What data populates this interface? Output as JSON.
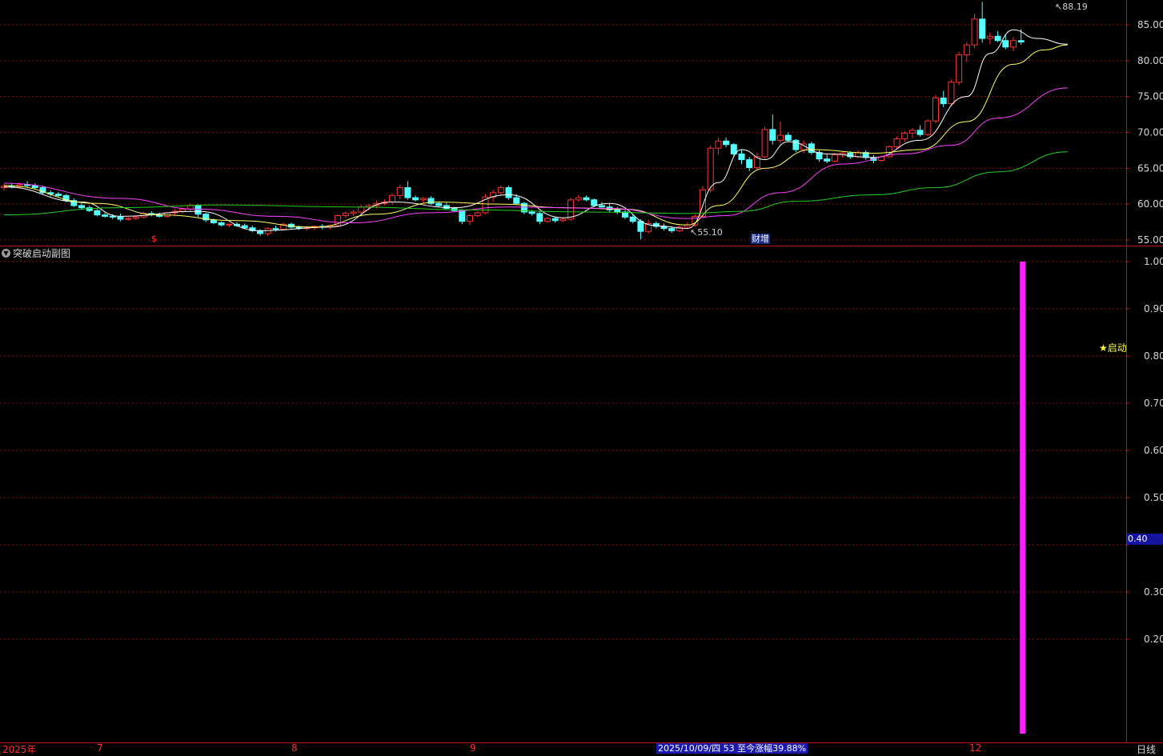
{
  "colors": {
    "up": "#ff3232",
    "down": "#54ffff",
    "ma5": "#ffffff",
    "ma10": "#ffff60",
    "ma20": "#ff40ff",
    "ma60": "#20d020",
    "grid": "#8a1010",
    "frame": "#c01010",
    "signal_bar": "#ff20ff"
  },
  "main_panel": {
    "y_ticks": [
      "85.00",
      "80.00",
      "75.00",
      "70.00",
      "65.00",
      "60.00",
      "55.00"
    ],
    "high_label": "88.19",
    "low_label": "55.10",
    "fin_marker": "财增",
    "s_marker": "$"
  },
  "sub_panel": {
    "title": "突破启动副图",
    "y_ticks": [
      "1.00",
      "0.90",
      "0.80",
      "0.70",
      "0.60",
      "0.50",
      "0.30",
      "0.20"
    ],
    "current_value": "0.40",
    "signal_label": "★启动",
    "signal_value": 1.0
  },
  "time_axis": {
    "labels": [
      {
        "text": "2025年",
        "id": "2025"
      },
      {
        "text": "7",
        "id": "m7"
      },
      {
        "text": "8",
        "id": "m8"
      },
      {
        "text": "9",
        "id": "m9"
      },
      {
        "text": "12",
        "id": "m12"
      }
    ],
    "date_info": "2025/10/09/四 53 至今涨幅39.88%",
    "period": "日线"
  },
  "chart_data": {
    "type": "candlestick",
    "price_range": [
      54,
      88.5
    ],
    "candles": [
      [
        62.3,
        62.8,
        61.9,
        62.5
      ],
      [
        62.5,
        62.9,
        62.2,
        62.4
      ],
      [
        62.4,
        63.0,
        62.3,
        62.7
      ],
      [
        62.7,
        63.2,
        62.4,
        62.6
      ],
      [
        62.6,
        62.9,
        62.1,
        62.3
      ],
      [
        62.3,
        62.6,
        61.4,
        61.6
      ],
      [
        61.6,
        61.9,
        61.1,
        61.4
      ],
      [
        61.4,
        61.7,
        61.0,
        61.2
      ],
      [
        61.2,
        61.4,
        60.3,
        60.5
      ],
      [
        60.5,
        60.8,
        59.6,
        59.8
      ],
      [
        59.8,
        60.1,
        59.2,
        59.5
      ],
      [
        59.5,
        59.8,
        58.9,
        59.1
      ],
      [
        59.1,
        59.3,
        58.3,
        58.5
      ],
      [
        58.5,
        58.8,
        58.1,
        58.3
      ],
      [
        58.3,
        58.6,
        57.9,
        58.2
      ],
      [
        58.2,
        58.7,
        57.6,
        57.9
      ],
      [
        57.9,
        58.2,
        57.7,
        58.0
      ],
      [
        58.0,
        58.4,
        57.8,
        58.2
      ],
      [
        58.2,
        58.9,
        58.0,
        58.7
      ],
      [
        58.7,
        59.0,
        58.3,
        58.5
      ],
      [
        58.5,
        58.8,
        58.1,
        58.3
      ],
      [
        58.3,
        58.9,
        58.1,
        58.8
      ],
      [
        58.8,
        59.3,
        58.5,
        59.0
      ],
      [
        59.0,
        59.5,
        58.7,
        59.3
      ],
      [
        59.3,
        60.1,
        59.0,
        59.8
      ],
      [
        59.8,
        60.0,
        58.2,
        58.6
      ],
      [
        58.6,
        58.8,
        57.5,
        57.8
      ],
      [
        57.8,
        58.0,
        57.2,
        57.4
      ],
      [
        57.4,
        57.6,
        56.9,
        57.1
      ],
      [
        57.1,
        57.3,
        56.8,
        57.2
      ],
      [
        57.2,
        57.5,
        56.8,
        57.0
      ],
      [
        57.0,
        57.3,
        56.5,
        56.7
      ],
      [
        56.7,
        57.0,
        56.1,
        56.3
      ],
      [
        56.3,
        56.5,
        55.6,
        55.9
      ],
      [
        55.9,
        56.8,
        55.6,
        56.6
      ],
      [
        56.6,
        57.0,
        56.2,
        56.5
      ],
      [
        56.5,
        57.4,
        56.3,
        57.2
      ],
      [
        57.2,
        57.4,
        56.6,
        56.8
      ],
      [
        56.8,
        57.0,
        56.4,
        56.6
      ],
      [
        56.6,
        56.9,
        56.3,
        56.7
      ],
      [
        56.7,
        57.0,
        56.4,
        56.9
      ],
      [
        56.9,
        57.2,
        56.5,
        56.8
      ],
      [
        56.8,
        57.1,
        56.5,
        57.0
      ],
      [
        57.0,
        58.6,
        56.8,
        58.4
      ],
      [
        58.4,
        59.0,
        58.1,
        58.7
      ],
      [
        58.7,
        59.2,
        58.4,
        58.9
      ],
      [
        58.9,
        59.9,
        58.6,
        59.6
      ],
      [
        59.6,
        60.0,
        59.1,
        59.8
      ],
      [
        59.8,
        60.5,
        59.4,
        60.1
      ],
      [
        60.1,
        60.7,
        59.8,
        60.3
      ],
      [
        60.3,
        61.5,
        59.9,
        61.2
      ],
      [
        61.2,
        62.7,
        60.7,
        62.3
      ],
      [
        62.3,
        63.2,
        60.6,
        60.9
      ],
      [
        60.9,
        61.2,
        60.4,
        60.6
      ],
      [
        60.6,
        61.0,
        60.1,
        60.8
      ],
      [
        60.8,
        61.1,
        59.9,
        60.1
      ],
      [
        60.1,
        60.4,
        59.6,
        59.8
      ],
      [
        59.8,
        60.2,
        59.2,
        59.4
      ],
      [
        59.4,
        59.6,
        58.9,
        59.1
      ],
      [
        59.1,
        59.3,
        57.2,
        57.6
      ],
      [
        57.6,
        58.6,
        57.1,
        58.4
      ],
      [
        58.4,
        59.0,
        58.2,
        58.8
      ],
      [
        58.8,
        61.4,
        58.6,
        61.0
      ],
      [
        61.0,
        62.0,
        60.3,
        61.6
      ],
      [
        61.6,
        62.6,
        61.3,
        62.3
      ],
      [
        62.3,
        62.6,
        60.6,
        60.9
      ],
      [
        60.9,
        61.4,
        59.9,
        60.1
      ],
      [
        60.1,
        60.3,
        58.6,
        58.9
      ],
      [
        58.9,
        59.2,
        58.4,
        58.7
      ],
      [
        58.7,
        59.0,
        57.2,
        57.6
      ],
      [
        57.6,
        58.2,
        57.4,
        58.0
      ],
      [
        58.0,
        58.3,
        57.4,
        57.7
      ],
      [
        57.7,
        58.1,
        57.5,
        57.9
      ],
      [
        57.9,
        60.9,
        57.7,
        60.6
      ],
      [
        60.6,
        61.3,
        60.3,
        60.9
      ],
      [
        60.9,
        61.2,
        60.4,
        60.6
      ],
      [
        60.6,
        60.8,
        59.6,
        59.8
      ],
      [
        59.8,
        60.3,
        59.3,
        59.6
      ],
      [
        59.6,
        60.1,
        58.9,
        59.2
      ],
      [
        59.2,
        59.6,
        58.6,
        58.9
      ],
      [
        58.9,
        59.2,
        57.9,
        58.2
      ],
      [
        58.2,
        58.5,
        57.3,
        57.6
      ],
      [
        57.6,
        57.9,
        55.1,
        56.2
      ],
      [
        56.2,
        57.8,
        55.9,
        57.3
      ],
      [
        57.3,
        57.6,
        56.6,
        56.9
      ],
      [
        56.9,
        57.3,
        56.3,
        56.6
      ],
      [
        56.6,
        56.9,
        56.0,
        56.3
      ],
      [
        56.3,
        57.0,
        56.1,
        56.8
      ],
      [
        56.8,
        57.4,
        56.5,
        57.1
      ],
      [
        57.1,
        58.6,
        56.9,
        58.3
      ],
      [
        58.3,
        62.5,
        58.1,
        62.0
      ],
      [
        62.0,
        68.2,
        61.6,
        67.8
      ],
      [
        67.8,
        69.3,
        66.9,
        68.8
      ],
      [
        68.8,
        69.3,
        67.9,
        68.3
      ],
      [
        68.3,
        68.5,
        66.6,
        67.0
      ],
      [
        67.0,
        67.6,
        65.6,
        66.2
      ],
      [
        66.2,
        66.6,
        64.6,
        65.1
      ],
      [
        65.1,
        67.2,
        64.7,
        66.6
      ],
      [
        66.6,
        70.8,
        66.3,
        70.4
      ],
      [
        70.4,
        72.5,
        68.3,
        68.9
      ],
      [
        68.9,
        71.5,
        68.5,
        69.6
      ],
      [
        69.6,
        70.0,
        68.7,
        68.9
      ],
      [
        68.9,
        69.1,
        67.3,
        67.6
      ],
      [
        67.6,
        68.9,
        67.1,
        68.4
      ],
      [
        68.4,
        68.7,
        66.9,
        67.2
      ],
      [
        67.2,
        67.5,
        65.9,
        66.3
      ],
      [
        66.3,
        67.0,
        65.7,
        66.0
      ],
      [
        66.0,
        67.2,
        65.8,
        66.9
      ],
      [
        66.9,
        67.4,
        66.5,
        67.1
      ],
      [
        67.1,
        67.4,
        66.3,
        66.6
      ],
      [
        66.6,
        67.5,
        66.4,
        67.2
      ],
      [
        67.2,
        67.5,
        66.2,
        66.5
      ],
      [
        66.5,
        66.9,
        65.7,
        66.1
      ],
      [
        66.1,
        66.8,
        65.9,
        66.6
      ],
      [
        66.6,
        68.2,
        66.5,
        68.0
      ],
      [
        68.0,
        69.4,
        67.7,
        69.1
      ],
      [
        69.1,
        70.2,
        68.6,
        69.9
      ],
      [
        69.9,
        70.6,
        69.2,
        70.3
      ],
      [
        70.3,
        71.0,
        69.4,
        69.7
      ],
      [
        69.7,
        71.8,
        69.5,
        71.6
      ],
      [
        71.6,
        75.2,
        71.3,
        74.8
      ],
      [
        74.8,
        75.8,
        73.5,
        74.0
      ],
      [
        74.0,
        77.3,
        73.7,
        77.0
      ],
      [
        77.0,
        81.2,
        76.6,
        80.8
      ],
      [
        80.8,
        82.6,
        79.8,
        82.2
      ],
      [
        82.2,
        86.5,
        81.8,
        85.8
      ],
      [
        85.8,
        88.2,
        82.5,
        83.1
      ],
      [
        83.1,
        83.9,
        82.3,
        83.4
      ],
      [
        83.4,
        84.1,
        82.6,
        82.8
      ],
      [
        82.8,
        83.6,
        81.6,
        81.9
      ],
      [
        81.9,
        83.3,
        81.3,
        82.8
      ],
      [
        82.8,
        84.4,
        82.2,
        82.6
      ]
    ],
    "ma": [
      {
        "name": "MA5",
        "color_key": "ma5",
        "values": [
          {
            "i": 0,
            "v": 62.4
          },
          {
            "i": 10,
            "v": 60.3
          },
          {
            "i": 15,
            "v": 58.3
          },
          {
            "i": 25,
            "v": 59.0
          },
          {
            "i": 33,
            "v": 56.3
          },
          {
            "i": 42,
            "v": 56.8
          },
          {
            "i": 50,
            "v": 60.3
          },
          {
            "i": 58,
            "v": 59.5
          },
          {
            "i": 65,
            "v": 61.3
          },
          {
            "i": 72,
            "v": 58.1
          },
          {
            "i": 78,
            "v": 60.1
          },
          {
            "i": 84,
            "v": 57.0
          },
          {
            "i": 88,
            "v": 56.6
          },
          {
            "i": 92,
            "v": 63.0
          },
          {
            "i": 95,
            "v": 67.6
          },
          {
            "i": 98,
            "v": 66.2
          },
          {
            "i": 101,
            "v": 68.7
          },
          {
            "i": 106,
            "v": 67.0
          },
          {
            "i": 112,
            "v": 66.5
          },
          {
            "i": 118,
            "v": 68.9
          },
          {
            "i": 124,
            "v": 75.0
          },
          {
            "i": 127,
            "v": 81.0
          },
          {
            "i": 130,
            "v": 84.3
          },
          {
            "i": 133,
            "v": 83.1
          },
          {
            "i": 137,
            "v": 82.3
          }
        ]
      },
      {
        "name": "MA10",
        "color_key": "ma10",
        "values": [
          {
            "i": 0,
            "v": 62.6
          },
          {
            "i": 12,
            "v": 60.1
          },
          {
            "i": 20,
            "v": 58.5
          },
          {
            "i": 30,
            "v": 57.7
          },
          {
            "i": 40,
            "v": 56.8
          },
          {
            "i": 48,
            "v": 58.6
          },
          {
            "i": 56,
            "v": 60.3
          },
          {
            "i": 64,
            "v": 60.0
          },
          {
            "i": 72,
            "v": 59.5
          },
          {
            "i": 80,
            "v": 59.3
          },
          {
            "i": 88,
            "v": 57.1
          },
          {
            "i": 92,
            "v": 59.8
          },
          {
            "i": 98,
            "v": 65.0
          },
          {
            "i": 104,
            "v": 67.6
          },
          {
            "i": 112,
            "v": 67.1
          },
          {
            "i": 118,
            "v": 67.6
          },
          {
            "i": 124,
            "v": 71.5
          },
          {
            "i": 130,
            "v": 79.5
          },
          {
            "i": 134,
            "v": 81.5
          },
          {
            "i": 137,
            "v": 82.2
          }
        ]
      },
      {
        "name": "MA20",
        "color_key": "ma20",
        "values": [
          {
            "i": 0,
            "v": 62.9
          },
          {
            "i": 15,
            "v": 60.8
          },
          {
            "i": 25,
            "v": 59.3
          },
          {
            "i": 35,
            "v": 58.3
          },
          {
            "i": 45,
            "v": 57.4
          },
          {
            "i": 55,
            "v": 58.8
          },
          {
            "i": 65,
            "v": 59.6
          },
          {
            "i": 78,
            "v": 59.4
          },
          {
            "i": 88,
            "v": 58.0
          },
          {
            "i": 93,
            "v": 58.4
          },
          {
            "i": 100,
            "v": 61.6
          },
          {
            "i": 108,
            "v": 65.6
          },
          {
            "i": 116,
            "v": 67.0
          },
          {
            "i": 122,
            "v": 68.2
          },
          {
            "i": 128,
            "v": 72.0
          },
          {
            "i": 137,
            "v": 76.2
          }
        ]
      },
      {
        "name": "MA60",
        "color_key": "ma60",
        "values": [
          {
            "i": 0,
            "v": 58.5
          },
          {
            "i": 15,
            "v": 59.5
          },
          {
            "i": 28,
            "v": 59.9
          },
          {
            "i": 45,
            "v": 59.6
          },
          {
            "i": 60,
            "v": 59.2
          },
          {
            "i": 75,
            "v": 58.9
          },
          {
            "i": 88,
            "v": 58.7
          },
          {
            "i": 95,
            "v": 59.0
          },
          {
            "i": 102,
            "v": 60.4
          },
          {
            "i": 112,
            "v": 61.3
          },
          {
            "i": 120,
            "v": 62.3
          },
          {
            "i": 128,
            "v": 64.5
          },
          {
            "i": 137,
            "v": 67.3
          }
        ]
      }
    ]
  }
}
